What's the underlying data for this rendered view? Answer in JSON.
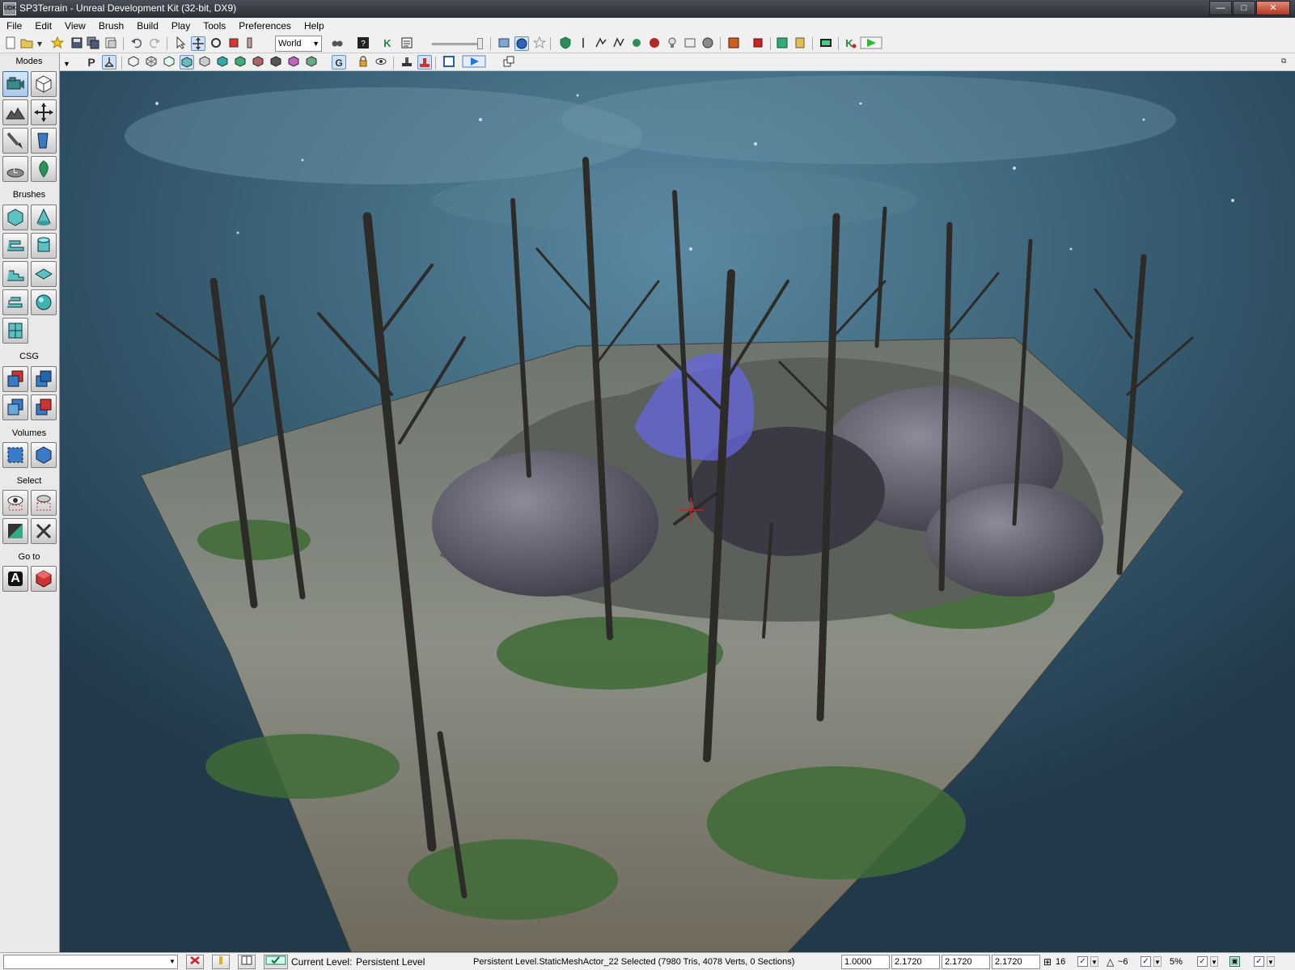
{
  "window": {
    "app_icon_label": "UDK",
    "title": "SP3Terrain - Unreal Development Kit (32-bit, DX9)",
    "controls": {
      "minimize": "—",
      "maximize": "□",
      "close": "✕"
    }
  },
  "menu": [
    "File",
    "Edit",
    "View",
    "Brush",
    "Build",
    "Play",
    "Tools",
    "Preferences",
    "Help"
  ],
  "toolbar": {
    "coord_system": "World",
    "icons": [
      "new-file-icon",
      "open-folder-icon",
      "favorite-star-icon",
      "save-icon",
      "save-all-icon",
      "save-copy-icon",
      "undo-icon",
      "redo-icon",
      "select-arrow-icon",
      "translate-icon",
      "rotate-icon",
      "scale-icon",
      "non-uniform-scale-icon",
      "search-icon",
      "kismet-k-icon",
      "matinee-icon",
      "browser-icon",
      "level-icon",
      "star-icon",
      "green-shield-icon",
      "build-geometry-icon",
      "build-lighting-icon",
      "build-paths-icon",
      "build-cover-icon",
      "build-all-icon",
      "light-bulb-icon",
      "fullscreen-icon",
      "lightmass-icon",
      "orange-square-icon",
      "red-stop-icon",
      "play-in-editor-icon",
      "pause-icon",
      "console-icon",
      "kismet-play-icon",
      "play-green-icon"
    ]
  },
  "viewport_toolbar": {
    "perspective_label": "P",
    "grid_label": "G"
  },
  "modes_panel": {
    "header": "Modes",
    "sections": {
      "brushes": "Brushes",
      "csg": "CSG",
      "volumes": "Volumes",
      "select": "Select",
      "goto": "Go to"
    },
    "goto_actor_label": "A"
  },
  "status": {
    "command_input": "",
    "current_level_label": "Current Level:",
    "current_level_value": "Persistent Level",
    "selection_info": "Persistent Level.StaticMeshActor_22 Selected (7980 Tris, 4078 Verts, 0 Sections)",
    "drag_scale": "1.0000",
    "scale_x": "2.1720",
    "scale_y": "2.1720",
    "scale_z": "2.1720",
    "grid_size": "16",
    "rotation_snap": "~6",
    "scale_snap": "5%"
  }
}
